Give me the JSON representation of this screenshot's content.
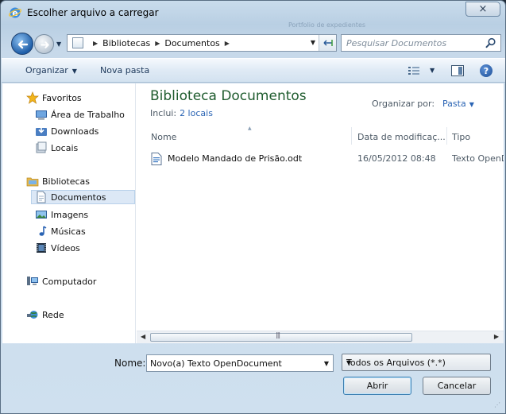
{
  "window": {
    "title": "Escolher arquivo a carregar",
    "ghost_title": "Portfolio de expedientes",
    "close_label": "×"
  },
  "address": {
    "crumbs": [
      "Bibliotecas",
      "Documentos"
    ],
    "search_placeholder": "Pesquisar Documentos"
  },
  "toolbar": {
    "organize_label": "Organizar",
    "new_folder_label": "Nova pasta",
    "help_label": "?"
  },
  "nav": {
    "favorites": "Favoritos",
    "desktop": "Área de Trabalho",
    "downloads": "Downloads",
    "places": "Locais",
    "libraries": "Bibliotecas",
    "documents": "Documentos",
    "images": "Imagens",
    "music": "Músicas",
    "videos": "Vídeos",
    "computer": "Computador",
    "network": "Rede"
  },
  "library": {
    "title": "Biblioteca Documentos",
    "includes_label": "Inclui:",
    "includes_link": "2 locais",
    "arrange_label": "Organizar por:",
    "arrange_value": "Pasta"
  },
  "columns": {
    "name": "Nome",
    "date": "Data de modificaç...",
    "type": "Tipo"
  },
  "files": [
    {
      "name": "Modelo Mandado de Prisão.odt",
      "date": "16/05/2012 08:48",
      "type": "Texto OpenDocument"
    }
  ],
  "footer": {
    "filename_label": "Nome:",
    "filename_value": "Novo(a) Texto OpenDocument",
    "filetype_value": "Todos os Arquivos (*.*)",
    "open_label": "Abrir",
    "cancel_label": "Cancelar"
  },
  "colors": {
    "library_title": "#1f5c2e",
    "link": "#2a64b4",
    "selection": "#dce8f6"
  }
}
